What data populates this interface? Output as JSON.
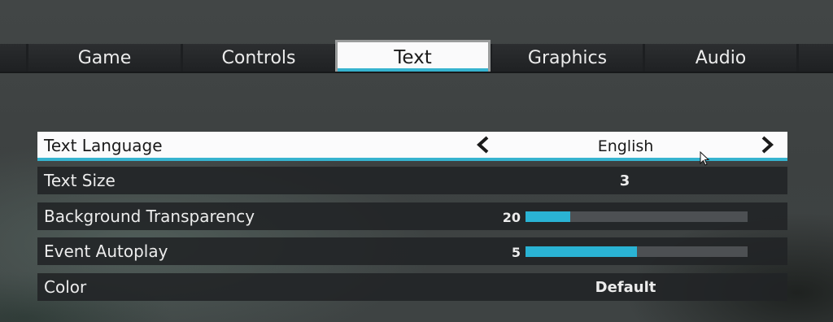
{
  "tabs": [
    {
      "label": "Game",
      "active": false
    },
    {
      "label": "Controls",
      "active": false
    },
    {
      "label": "Text",
      "active": true
    },
    {
      "label": "Graphics",
      "active": false
    },
    {
      "label": "Audio",
      "active": false
    }
  ],
  "settings": {
    "text_language": {
      "label": "Text Language",
      "value": "English"
    },
    "text_size": {
      "label": "Text Size",
      "value": "3"
    },
    "background_transparency": {
      "label": "Background Transparency",
      "value": "20",
      "fill_fraction": 0.2
    },
    "event_autoplay": {
      "label": "Event Autoplay",
      "value": "5",
      "fill_fraction": 0.5
    },
    "color": {
      "label": "Color",
      "value": "Default"
    }
  },
  "colors": {
    "accent": "#36b3cf",
    "selected_row": "#fbfbfc",
    "row_background": "#212325"
  },
  "icons": {
    "prev": "chevron-left-icon",
    "next": "chevron-right-icon",
    "cursor": "mouse-cursor-icon"
  }
}
